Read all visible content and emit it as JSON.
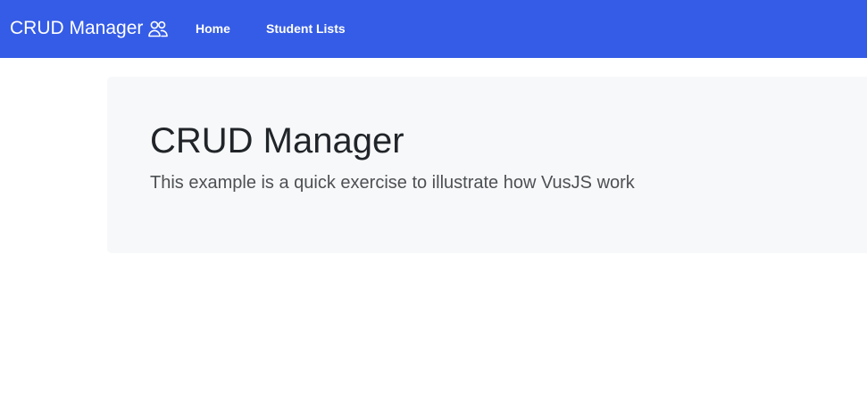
{
  "navbar": {
    "brand": "CRUD Manager",
    "brand_icon": "users-icon",
    "links": [
      {
        "label": "Home"
      },
      {
        "label": "Student Lists"
      }
    ],
    "background": "#355ce6"
  },
  "jumbotron": {
    "title": "CRUD Manager",
    "lead": "This example is a quick exercise to illustrate how VusJS work",
    "background": "#f7f8f9"
  }
}
